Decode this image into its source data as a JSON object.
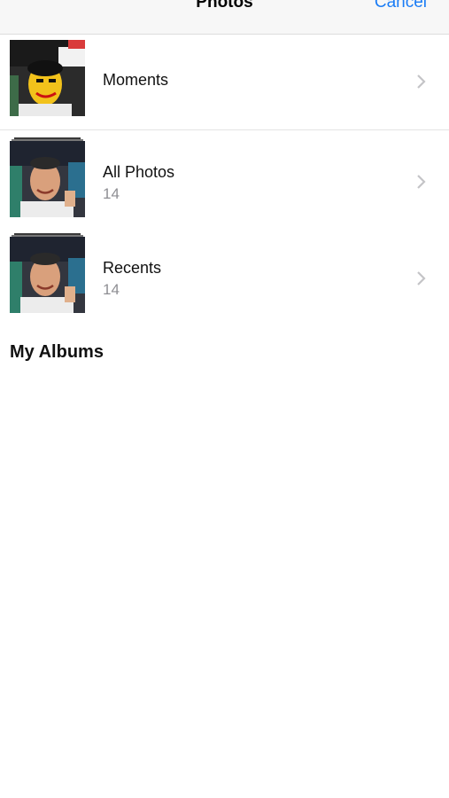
{
  "header": {
    "title": "Photos",
    "cancel_label": "Cancel"
  },
  "albums": [
    {
      "label": "Moments",
      "count": ""
    },
    {
      "label": "All Photos",
      "count": "14"
    },
    {
      "label": "Recents",
      "count": "14"
    }
  ],
  "section": {
    "my_albums": "My Albums"
  },
  "colors": {
    "accent": "#1a7cf5",
    "secondary_text": "#8e8e93",
    "nav_background": "#f7f7f7"
  },
  "icons": {
    "row_disclosure": "chevron-right-icon"
  }
}
